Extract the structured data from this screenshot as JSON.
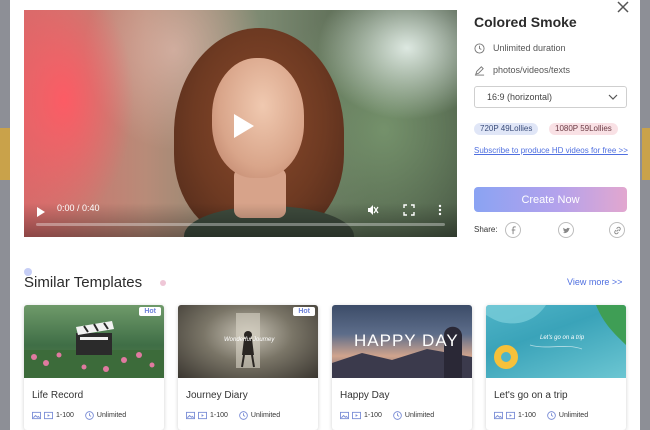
{
  "template": {
    "title": "Colored Smoke",
    "duration": "Unlimited duration",
    "media": "photos/videos/texts",
    "ratio": "16:9 (horizontal)",
    "price_720": "720P 49Lollies",
    "price_1080": "1080P 59Lollies",
    "subscribe_text": "Subscribe to produce HD videos for free >>",
    "create_label": "Create Now",
    "share_label": "Share:"
  },
  "player": {
    "time": "0:00 / 0:40",
    "progress": 0
  },
  "similar": {
    "heading": "Similar Templates",
    "view_more": "View more >>",
    "cards": [
      {
        "name": "Life Record",
        "badge": "Hot",
        "range": "1-100",
        "duration": "Unlimited"
      },
      {
        "name": "Journey Diary",
        "badge": "Hot",
        "thumb_text": "Wonderful Journey",
        "range": "1-100",
        "duration": "Unlimited"
      },
      {
        "name": "Happy Day",
        "thumb_text": "HAPPY DAY",
        "range": "1-100",
        "duration": "Unlimited"
      },
      {
        "name": "Let's go on a trip",
        "thumb_text": "Let's go on a trip",
        "range": "1-100",
        "duration": "Unlimited"
      }
    ]
  },
  "colors": {
    "accent": "#4f6fe0",
    "create_gradient_start": "#8aa3f3",
    "create_gradient_end": "#e2a7cf"
  },
  "icons": [
    "close-icon",
    "clock-icon",
    "pen-icon",
    "chevron-down-icon",
    "play-icon",
    "mute-icon",
    "fullscreen-icon",
    "more-vert-icon",
    "facebook-icon",
    "twitter-icon",
    "link-icon",
    "image-icon",
    "video-icon"
  ]
}
